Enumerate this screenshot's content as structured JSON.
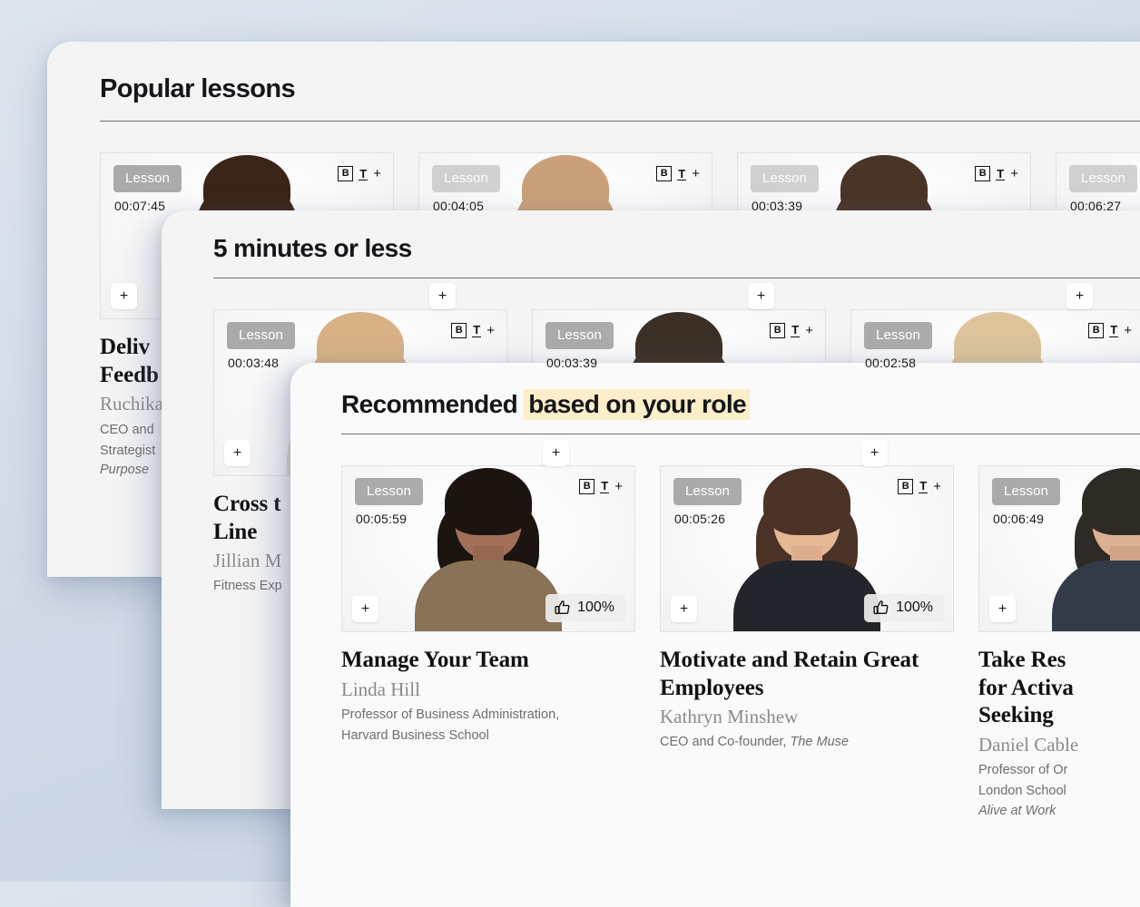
{
  "colors": {
    "page_background": "#d3dce9",
    "panel_background": "#f4f4f4",
    "panel_front_background": "#fafafa",
    "highlight": "#fbeec8",
    "badge_grey": "#8c8c8c",
    "text_primary": "#101114",
    "text_muted": "#6e6e6e"
  },
  "icons": {
    "format_bold": "B",
    "format_text": "T",
    "format_plus": "+",
    "add_button": "+",
    "thumbs_up": "thumbs-up-icon"
  },
  "badge_label": "Lesson",
  "panels": [
    {
      "id": "popular-lessons",
      "title": "Popular lessons",
      "title_plain": "Popular lessons",
      "highlight_text": "",
      "cards": [
        {
          "badge": "Lesson",
          "duration": "00:07:45",
          "title": "Deliver Feedback",
          "title_line1": "Deliv",
          "title_line2": "Feedb",
          "author": "Ruchika",
          "role": "CEO and\nStrategist",
          "book": "Purpose",
          "rating": "",
          "hair": "#3a2418",
          "skin": "#e9c3a4",
          "body": "#2f3338"
        },
        {
          "badge": "Lesson",
          "duration": "00:04:05",
          "title": "",
          "author": "",
          "role": "",
          "book": "",
          "rating": "",
          "hair": "#c9a079",
          "skin": "#f0d3bb",
          "body": "#e8e4df"
        },
        {
          "badge": "Lesson",
          "duration": "00:03:39",
          "title": "",
          "author": "",
          "role": "",
          "book": "",
          "rating": "",
          "hair": "#4a3428",
          "skin": "#e8bd9b",
          "body": "#4a4f55"
        },
        {
          "badge": "Lesson",
          "duration": "00:06:27",
          "title": "",
          "author": "",
          "role": "",
          "book": "",
          "rating": "",
          "hair": "#6b5542",
          "skin": "#eec9ad",
          "body": "#55595e"
        }
      ]
    },
    {
      "id": "five-minutes-or-less",
      "title": "5 minutes or less",
      "title_plain": "5 minutes or less",
      "highlight_text": "",
      "cards": [
        {
          "badge": "Lesson",
          "duration": "00:03:48",
          "title": "Cross the Line",
          "title_line1": "Cross t",
          "title_line2": "Line",
          "author": "Jillian M",
          "role": "Fitness Exp",
          "book": "",
          "rating": "",
          "hair": "#d8b184",
          "skin": "#f1cdae",
          "body": "#e3ddd6"
        },
        {
          "badge": "Lesson",
          "duration": "00:03:39",
          "title": "",
          "author": "",
          "role": "",
          "book": "",
          "rating": "",
          "hair": "#3c3026",
          "skin": "#e6bc9c",
          "body": "#3e4349"
        },
        {
          "badge": "Lesson",
          "duration": "00:02:58",
          "title": "",
          "author": "",
          "role": "",
          "book": "",
          "rating": "",
          "hair": "#ddc49a",
          "skin": "#f3cfb5",
          "body": "#ded8d0"
        }
      ]
    },
    {
      "id": "recommended-based-on-your-role",
      "title": "Recommended based on your role",
      "title_plain": "Recommended ",
      "highlight_text": "based on your role",
      "cards": [
        {
          "badge": "Lesson",
          "duration": "00:05:59",
          "title": "Manage Your Team",
          "author": "Linda Hill",
          "role": "Professor of Business Administration,\nHarvard Business School",
          "book": "",
          "rating": "100%",
          "hair": "#1c1410",
          "skin": "#a2705a",
          "body": "#8a7256"
        },
        {
          "badge": "Lesson",
          "duration": "00:05:26",
          "title": "Motivate and Retain Great Employees",
          "author": "Kathryn Minshew",
          "role": "CEO and Co-founder, ",
          "book": "The Muse",
          "rating": "100%",
          "hair": "#4a3226",
          "skin": "#e5b795",
          "body": "#23252a"
        },
        {
          "badge": "Lesson",
          "duration": "00:06:49",
          "title": "Take Responsibility for Activating Job Seeking Skills",
          "title_line1": "Take Res",
          "title_line2": "for Activa",
          "title_line3": "Seeking ",
          "author": "Daniel Cable",
          "role": "Professor of Or\nLondon School",
          "book": "Alive at Work",
          "rating": "",
          "hair": "#2e2a26",
          "skin": "#dcb094",
          "body": "#343b48"
        }
      ]
    }
  ]
}
